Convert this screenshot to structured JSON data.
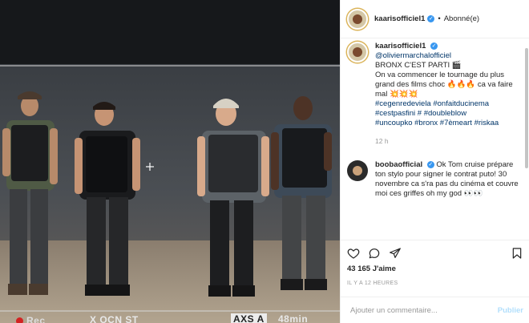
{
  "header": {
    "username": "kaarisofficiel1",
    "follow_status": "Abonné(e)"
  },
  "caption": {
    "username": "kaarisofficiel1",
    "mention": "@oliviermarchalofficiel",
    "line1": "BRONX C'EST PARTI 🎬",
    "line2": "On va commencer le tournage du plus grand des films choc 🔥🔥🔥 ca va faire mal 💥💥💥",
    "hashtags1": "#cegenredeviela #onfaitducinema",
    "hashtags2": "#cestpasfini # #doubleblow",
    "hashtags3": "#uncoupko #bronx #7èmeart #riskaa",
    "time": "12 h"
  },
  "comment": {
    "username": "boobaofficial",
    "text": "Ok Tom cruise prépare ton stylo pour signer le contrat puto! 30 novembre ca s'ra pas du cinéma et couvre moi ces griffes oh my god 👀👀"
  },
  "stats": {
    "likes": "43 165 J'aime",
    "posted": "IL Y A 12 HEURES"
  },
  "add_comment": {
    "placeholder": "Ajouter un commentaire...",
    "publish_label": "Publier"
  },
  "video_overlay": {
    "rec": "Rec",
    "code": "X OCN ST",
    "axs": "AXS A",
    "minutes": "48min"
  },
  "icons": {
    "like": "heart-icon",
    "comment": "comment-icon",
    "share": "share-icon",
    "save": "bookmark-icon",
    "verified": "verified-badge-icon"
  },
  "colors": {
    "verified": "#3897f0",
    "link": "#003569",
    "publish": "#b2dffc",
    "muted": "#999999"
  }
}
